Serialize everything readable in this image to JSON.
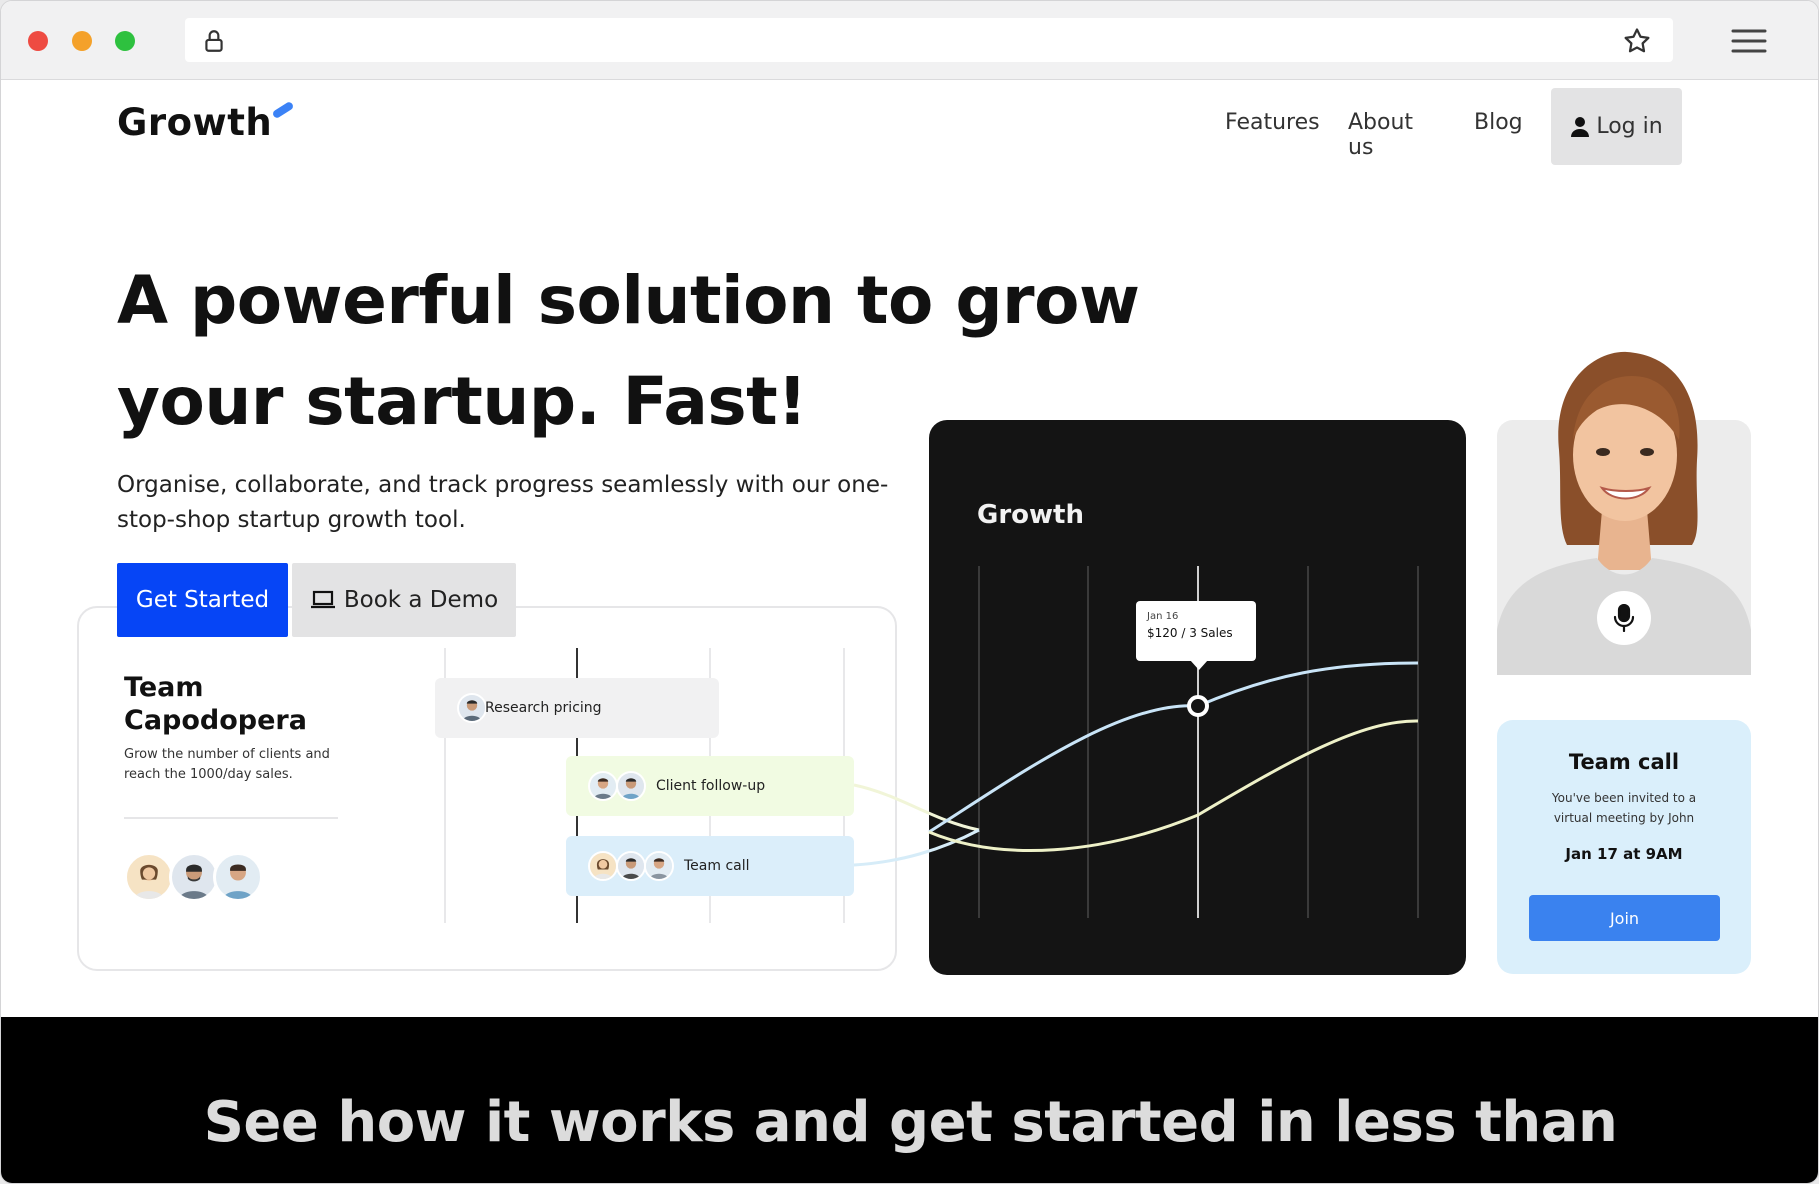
{
  "browser": {
    "icons": [
      "lock-icon",
      "star-icon",
      "menu-icon"
    ],
    "traffic_lights": {
      "close": "#ee4b42",
      "minimize": "#f4a12a",
      "maximize": "#2ec13f"
    }
  },
  "header": {
    "logo": "Growth",
    "nav": {
      "features": "Features",
      "about": "About us",
      "blog": "Blog",
      "login": "Log in"
    }
  },
  "hero": {
    "headline": "A powerful solution to grow your startup. Fast!",
    "subheading": "Organise, collaborate, and track progress seamlessly with our one-stop-shop startup growth tool.",
    "primary_cta": "Get Started",
    "secondary_cta": "Book a Demo"
  },
  "team_card": {
    "title": "Team Capodopera",
    "description": "Grow the number of clients and reach the 1000/day sales.",
    "tasks": [
      {
        "label": "Research pricing",
        "assignees": 1
      },
      {
        "label": "Client follow-up",
        "assignees": 2
      },
      {
        "label": "Team call",
        "assignees": 3
      }
    ]
  },
  "growth_card": {
    "title": "Growth",
    "tooltip": {
      "date": "Jan 16",
      "value": "$120 / 3 Sales"
    }
  },
  "call_card": {
    "title": "Team call",
    "description": "You've been invited to a virtual meeting by John",
    "time": "Jan 17 at 9AM",
    "join_label": "Join"
  },
  "band": {
    "title": "See how it works and get started in less than"
  },
  "colors": {
    "primary": "#0645f6",
    "accent_blue": "#3a82ef",
    "dark_card": "#141414",
    "call_card_bg": "#daeffb",
    "task_green": "#f1fbe2",
    "task_blue": "#dbeefa"
  }
}
